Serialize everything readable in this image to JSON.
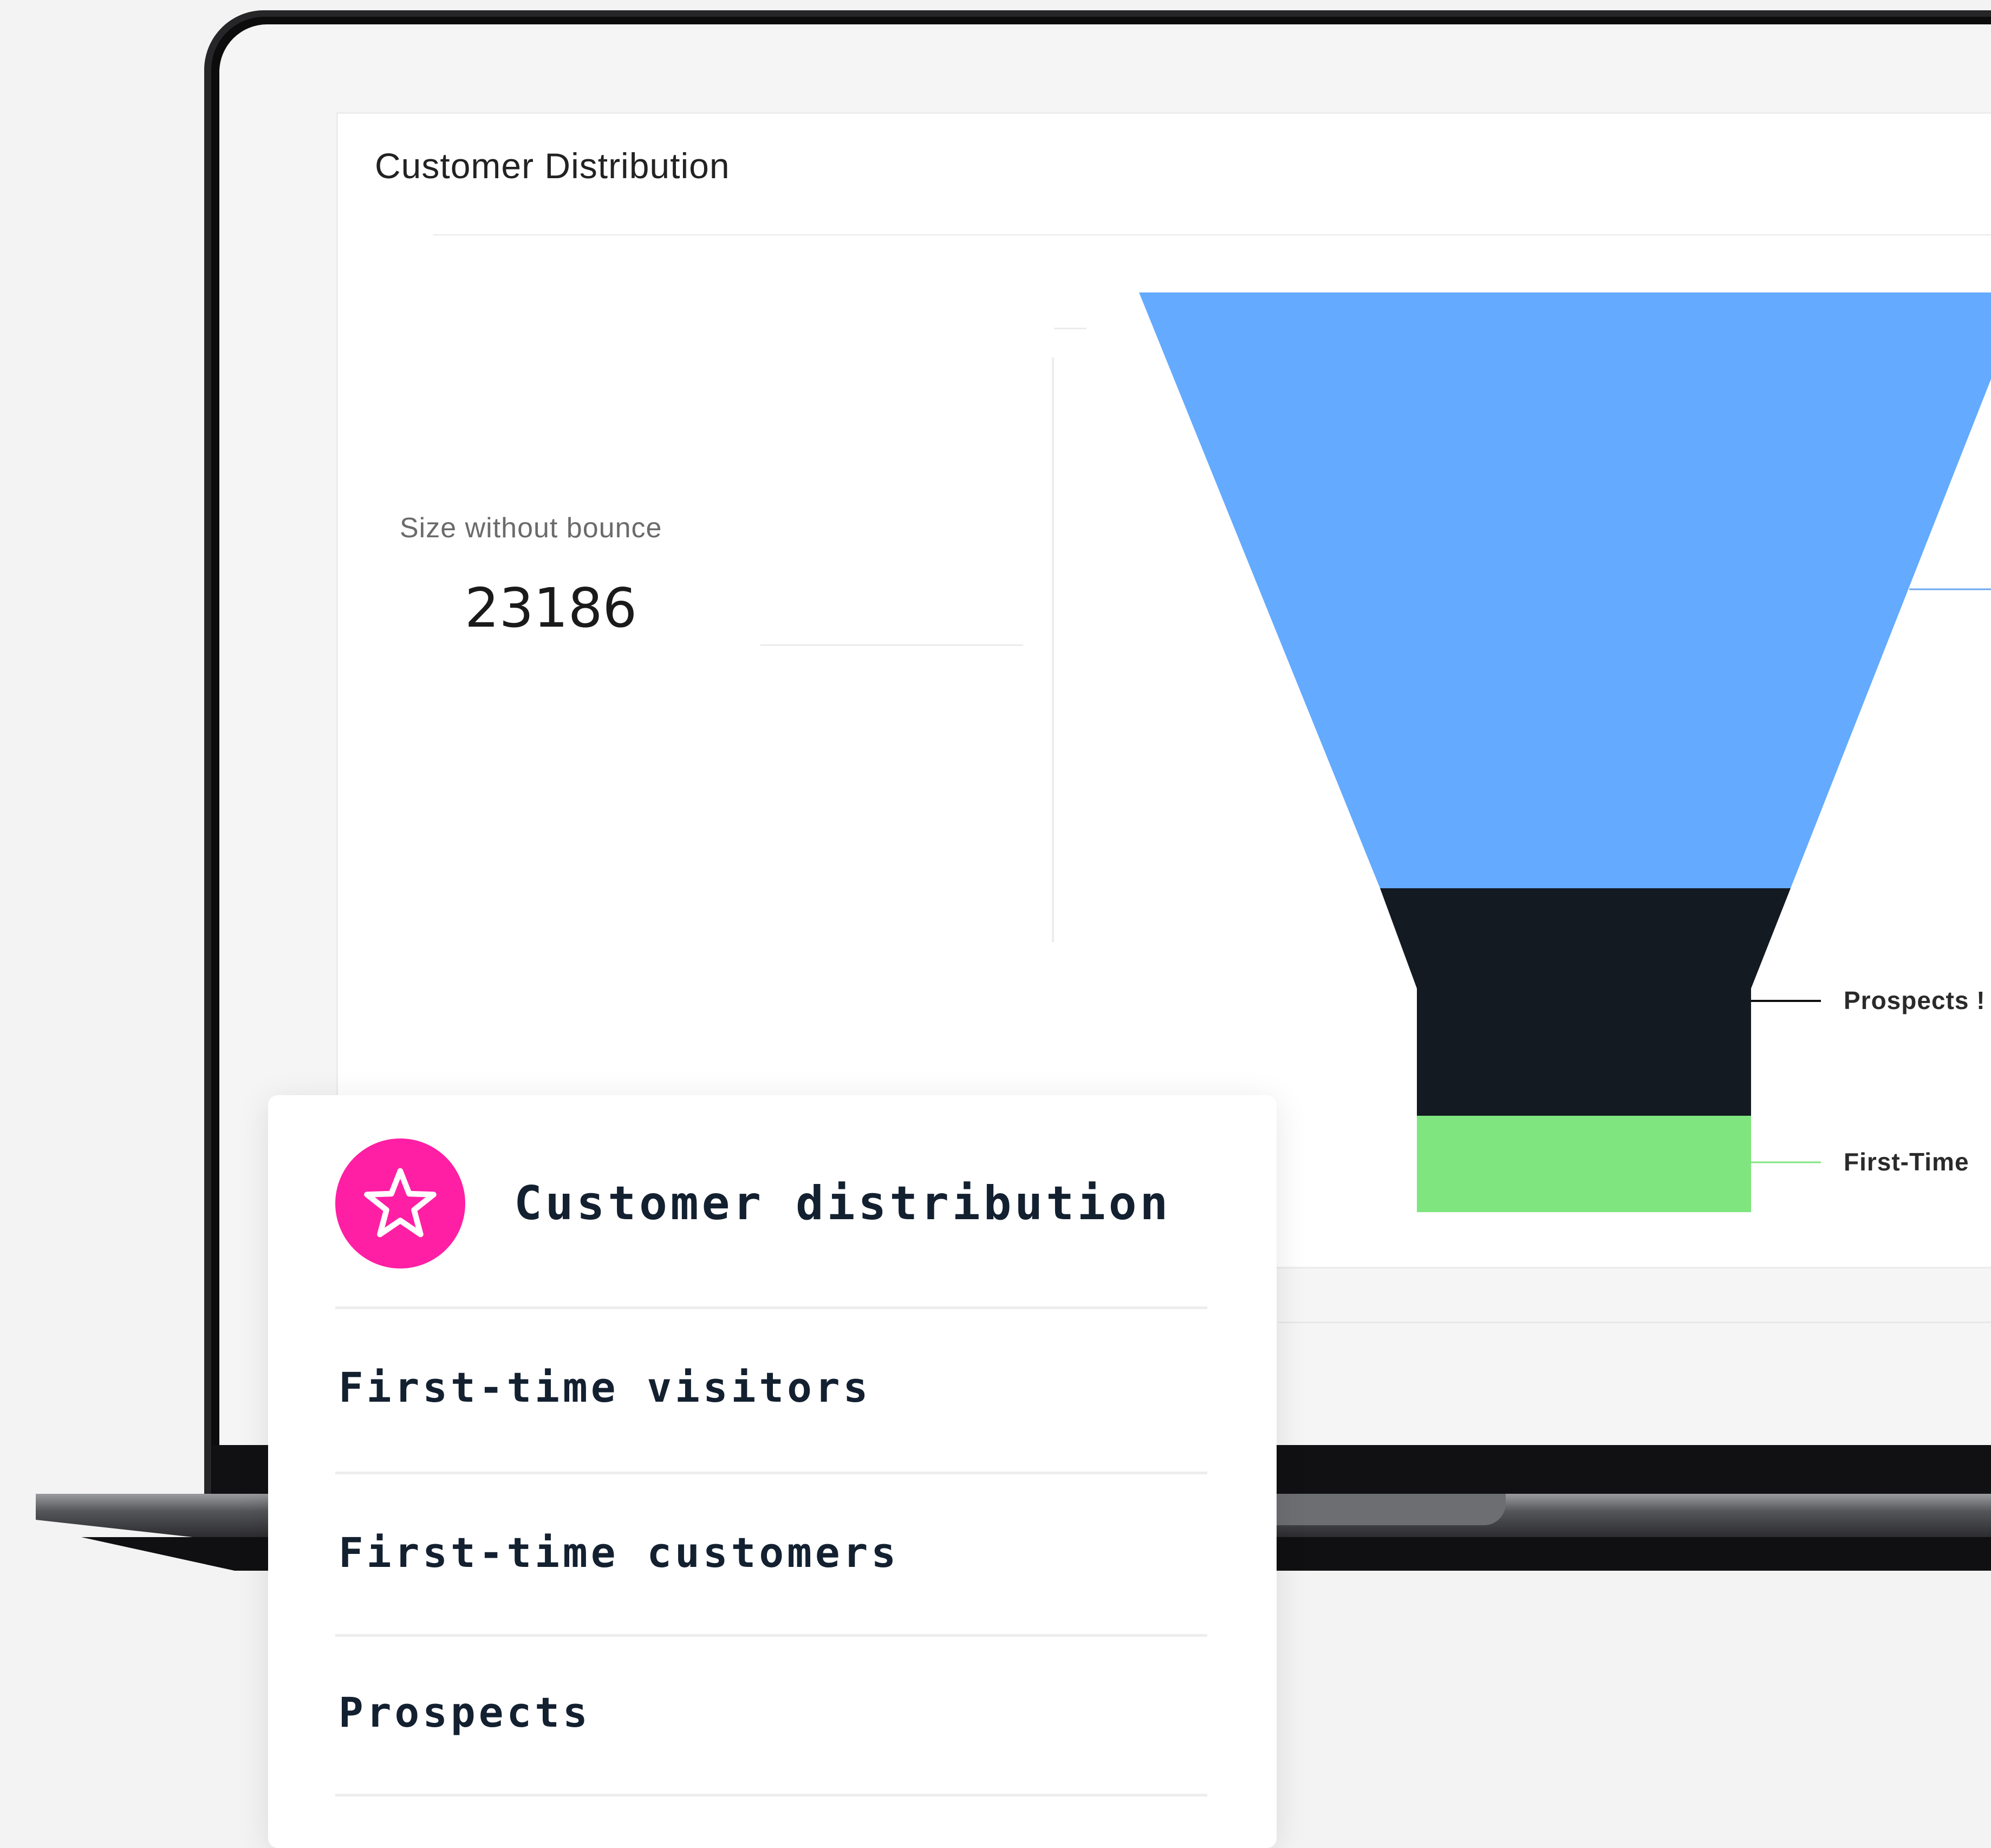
{
  "dashboard": {
    "title": "Customer Distribution",
    "metric_label": "Size without bounce",
    "metric_value": "23186"
  },
  "funnel": {
    "labels": {
      "prospects": "Prospects !",
      "first_time": "First-Time"
    },
    "colors": {
      "top": "#64aaff",
      "middle": "#141a22",
      "bottom": "#7fe57f"
    }
  },
  "card": {
    "icon": "star-icon",
    "icon_color": "#ff1fa4",
    "title": "Customer distribution",
    "items": [
      {
        "label": "First-time visitors"
      },
      {
        "label": "First-time customers"
      },
      {
        "label": "Prospects"
      }
    ]
  }
}
